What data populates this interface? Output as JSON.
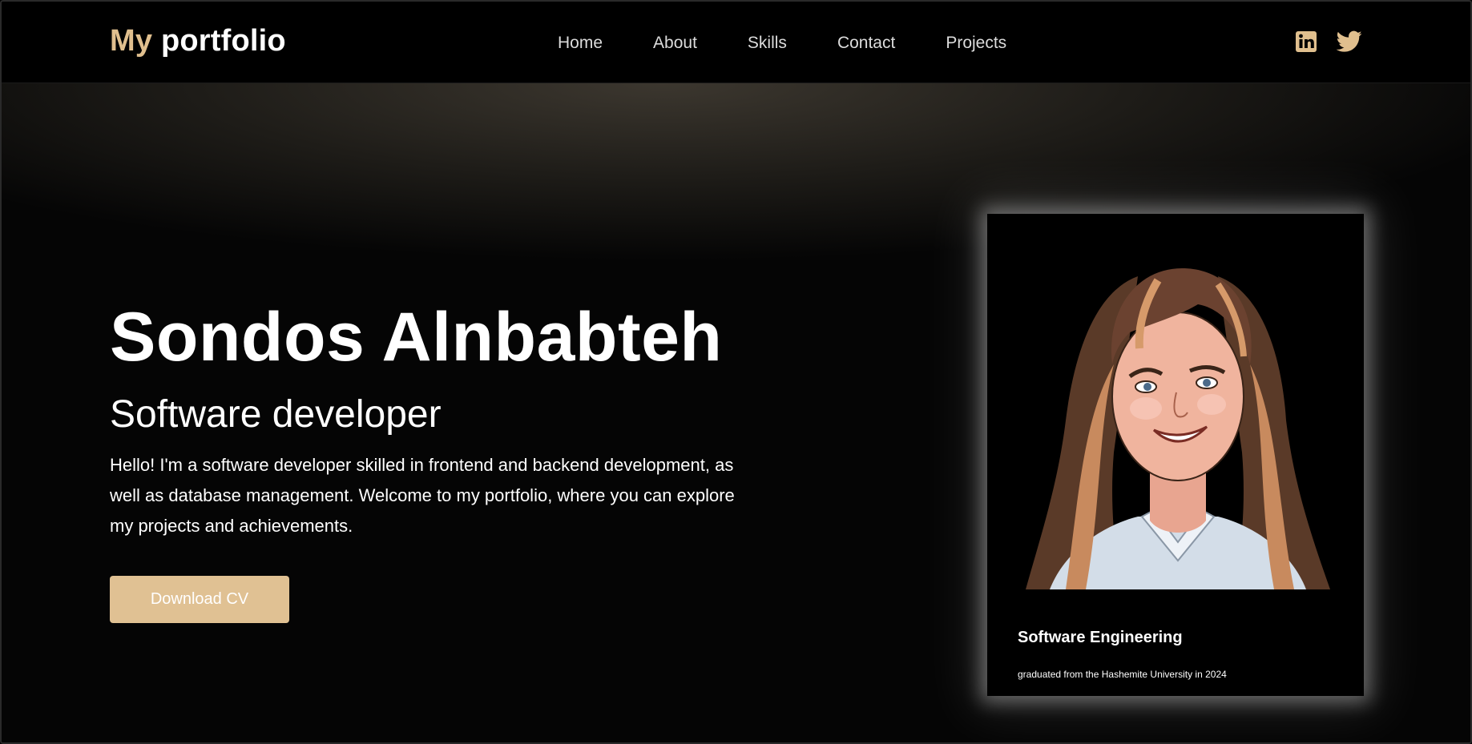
{
  "brand": {
    "accent": "My",
    "rest": "portfolio"
  },
  "nav": {
    "items": [
      {
        "label": "Home"
      },
      {
        "label": "About"
      },
      {
        "label": "Skills"
      },
      {
        "label": "Contact"
      },
      {
        "label": "Projects"
      }
    ]
  },
  "social": {
    "icons": [
      "linkedin-icon",
      "twitter-icon"
    ],
    "color": "#e0bf8e"
  },
  "hero": {
    "name": "Sondos Alnbabteh",
    "role": "Software developer",
    "bio": "Hello! I'm a software developer skilled in frontend and backend development, as well as database management. Welcome to my portfolio, where you can explore my projects and achievements.",
    "cta_label": "Download CV"
  },
  "card": {
    "title": "Software Engineering",
    "subtitle": "graduated from the Hashemite University in 2024"
  },
  "colors": {
    "accent": "#e0bf8e",
    "button": "#e0c193",
    "background": "#020202"
  }
}
